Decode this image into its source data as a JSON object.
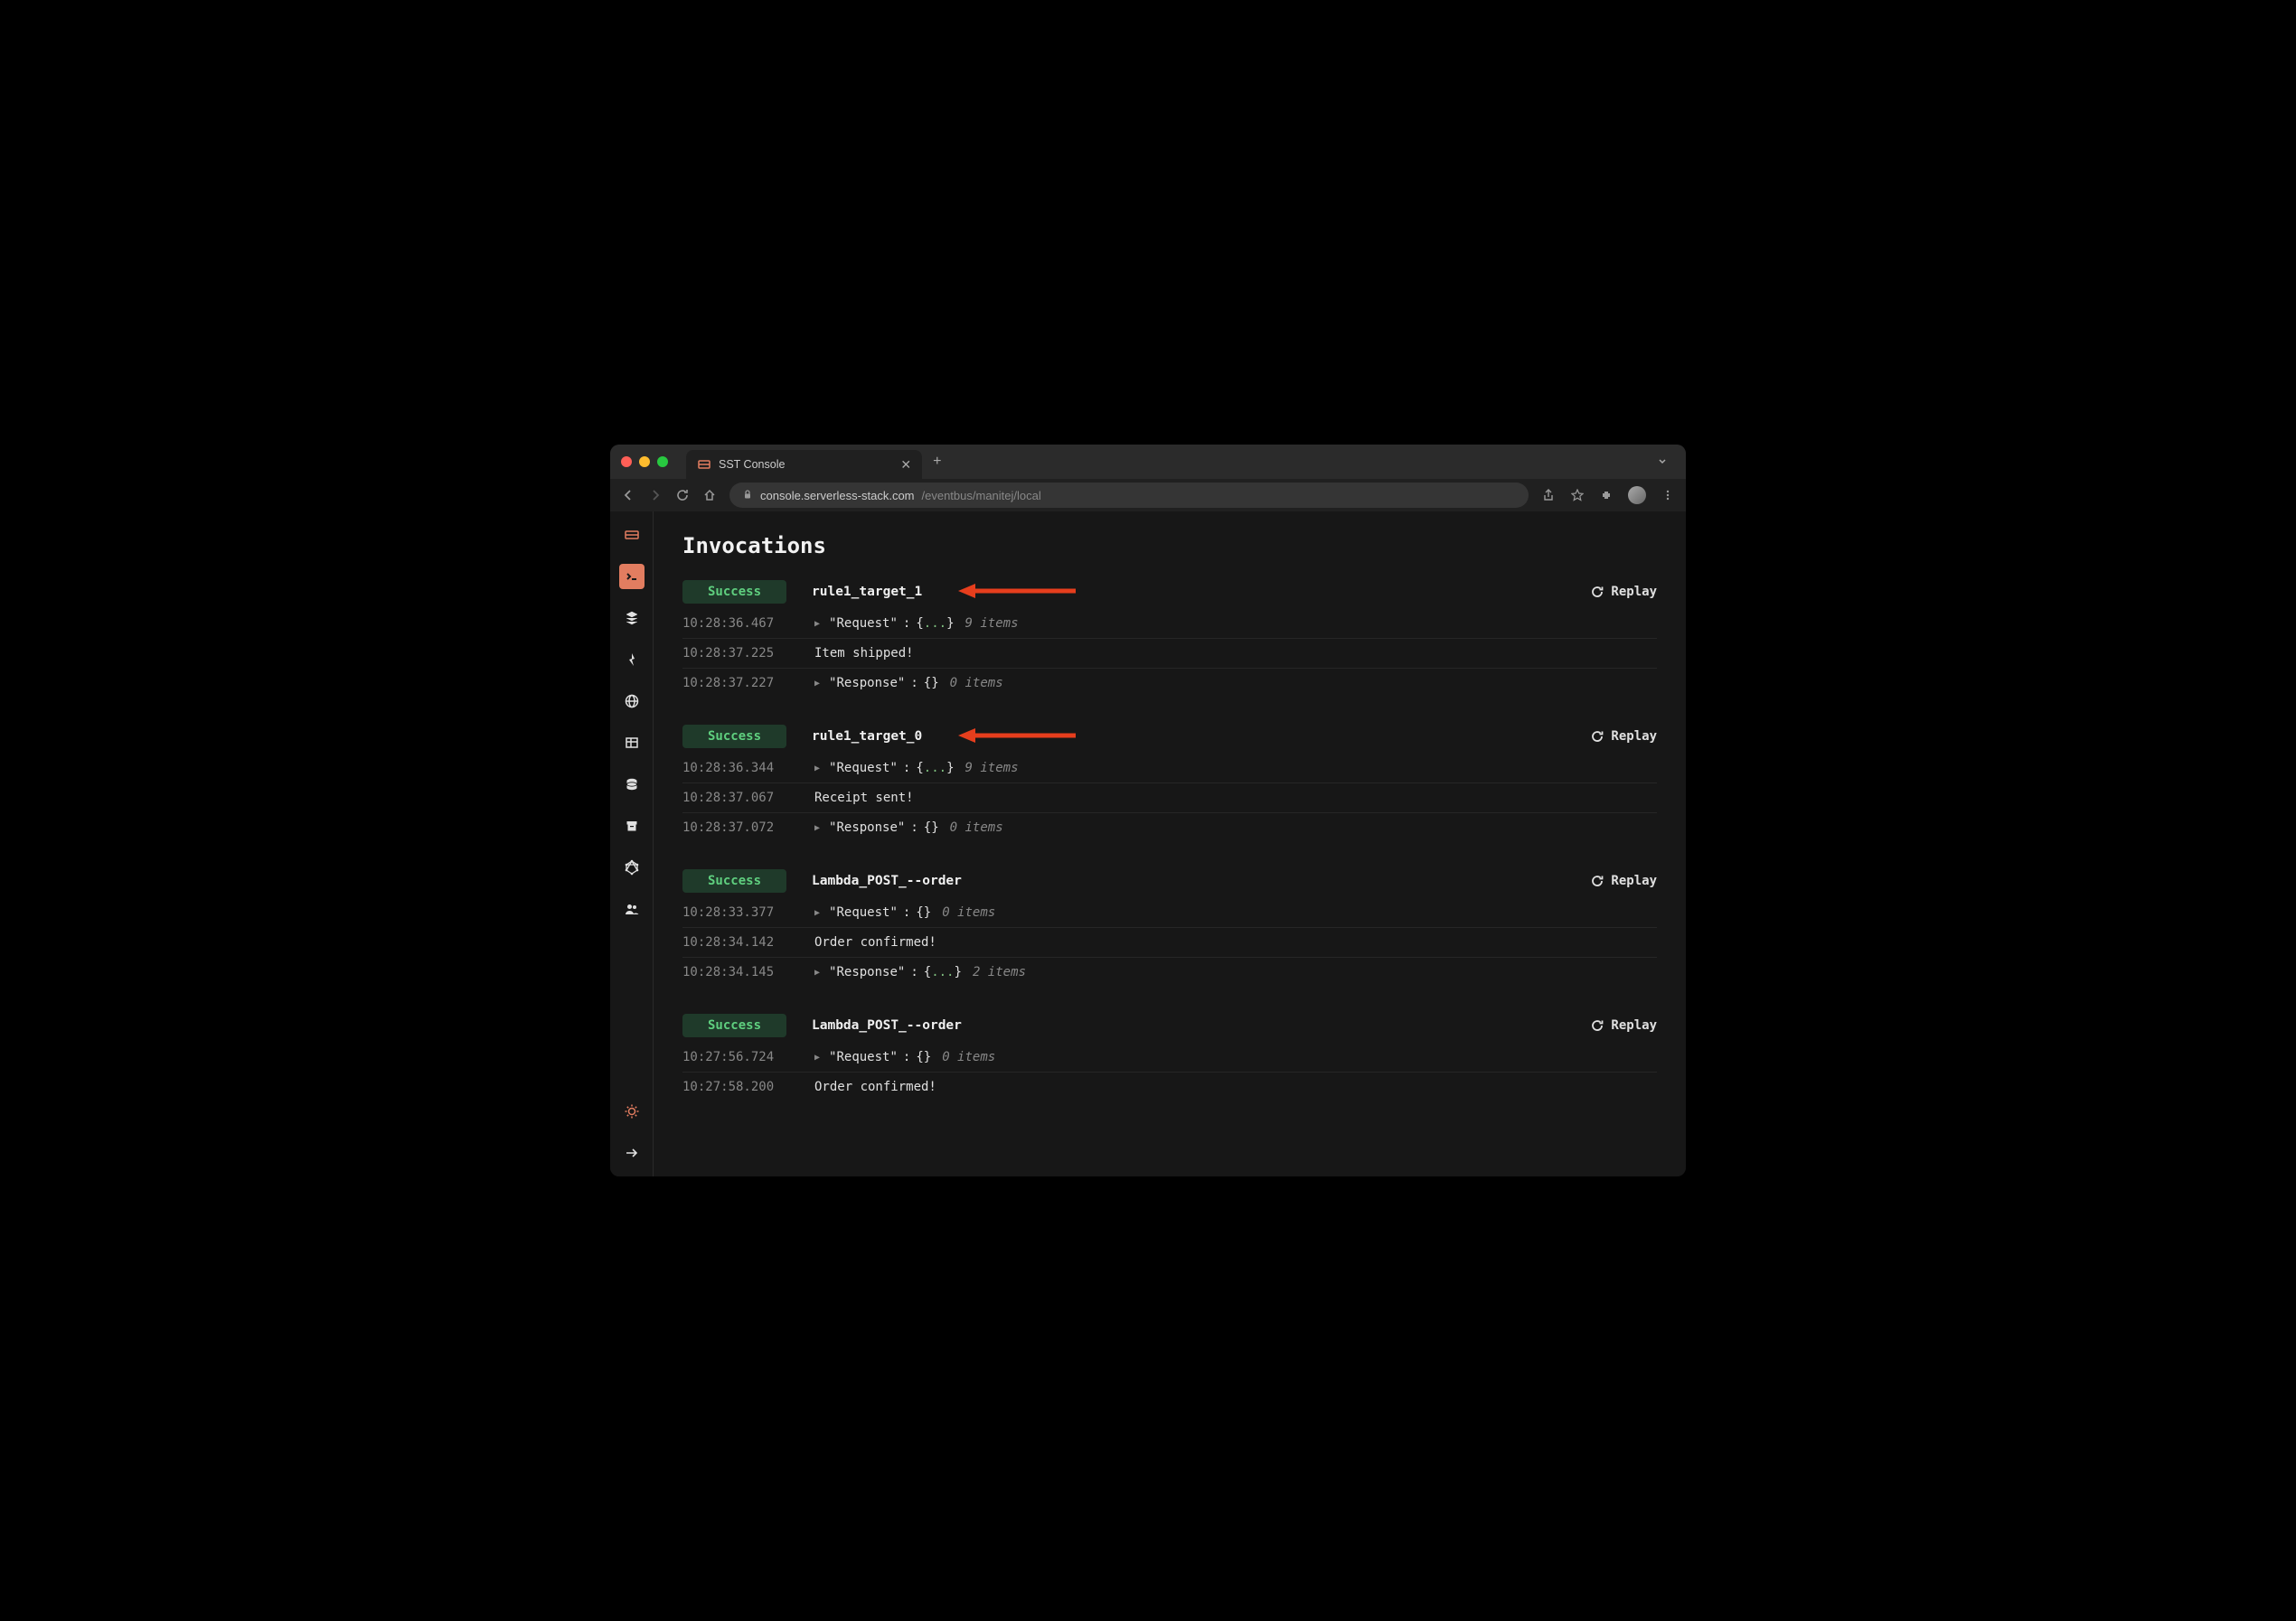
{
  "browser": {
    "tab_title": "SST Console",
    "url_host": "console.serverless-stack.com",
    "url_path": "/eventbus/manitej/local"
  },
  "page": {
    "title": "Invocations",
    "replay_label": "Replay"
  },
  "invocations": [
    {
      "status": "Success",
      "name": "rule1_target_1",
      "has_arrow": true,
      "rows": [
        {
          "ts": "10:28:36.467",
          "type": "json",
          "label": "Request",
          "braces": "{...}",
          "count": "9 items"
        },
        {
          "ts": "10:28:37.225",
          "type": "text",
          "text": "Item shipped!"
        },
        {
          "ts": "10:28:37.227",
          "type": "json",
          "label": "Response",
          "braces": "{}",
          "count": "0 items"
        }
      ]
    },
    {
      "status": "Success",
      "name": "rule1_target_0",
      "has_arrow": true,
      "rows": [
        {
          "ts": "10:28:36.344",
          "type": "json",
          "label": "Request",
          "braces": "{...}",
          "count": "9 items"
        },
        {
          "ts": "10:28:37.067",
          "type": "text",
          "text": "Receipt sent!"
        },
        {
          "ts": "10:28:37.072",
          "type": "json",
          "label": "Response",
          "braces": "{}",
          "count": "0 items"
        }
      ]
    },
    {
      "status": "Success",
      "name": "Lambda_POST_--order",
      "has_arrow": false,
      "rows": [
        {
          "ts": "10:28:33.377",
          "type": "json",
          "label": "Request",
          "braces": "{}",
          "count": "0 items"
        },
        {
          "ts": "10:28:34.142",
          "type": "text",
          "text": "Order confirmed!"
        },
        {
          "ts": "10:28:34.145",
          "type": "json",
          "label": "Response",
          "braces": "{...}",
          "count": "2 items"
        }
      ]
    },
    {
      "status": "Success",
      "name": "Lambda_POST_--order",
      "has_arrow": false,
      "rows": [
        {
          "ts": "10:27:56.724",
          "type": "json",
          "label": "Request",
          "braces": "{}",
          "count": "0 items"
        },
        {
          "ts": "10:27:58.200",
          "type": "text",
          "text": "Order confirmed!"
        }
      ]
    }
  ]
}
